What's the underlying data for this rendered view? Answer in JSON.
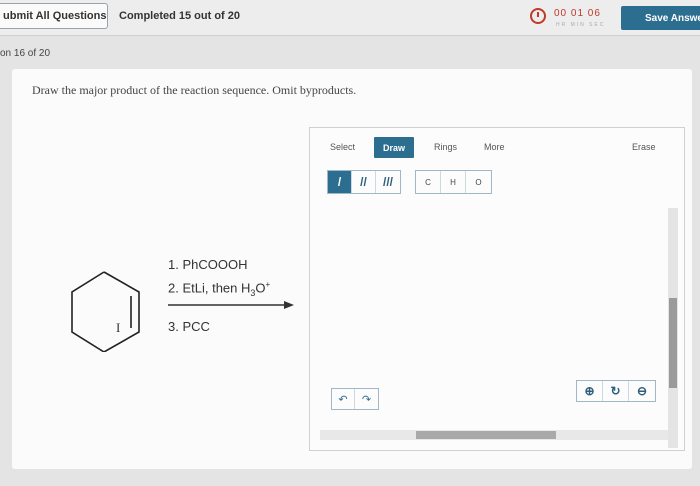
{
  "topbar": {
    "submit_label": "ubmit All Questions",
    "progress": "Completed 15 out of 20",
    "timer": {
      "value": "00 01 06",
      "units": "HR MIN SEC"
    },
    "save_label": "Save Answer"
  },
  "question_number": "on 16 of 20",
  "prompt": "Draw the major product of the reaction sequence. Omit byproducts.",
  "reaction": {
    "reactant_label": "I",
    "step1": "1. PhCOOOH",
    "step2_pre": "2. EtLi, then H",
    "step2_sub": "3",
    "step2_post": "O",
    "step2_sup": "+",
    "step3": "3. PCC"
  },
  "sketcher": {
    "tabs": {
      "select": "Select",
      "draw": "Draw",
      "rings": "Rings",
      "more": "More",
      "erase": "Erase"
    },
    "bonds": [
      "/",
      "//",
      "///"
    ],
    "atoms": [
      "C",
      "H",
      "O"
    ],
    "undo": "↶",
    "redo": "↷",
    "zoom_in": "⊕",
    "reset": "↻",
    "zoom_out": "⊖"
  }
}
